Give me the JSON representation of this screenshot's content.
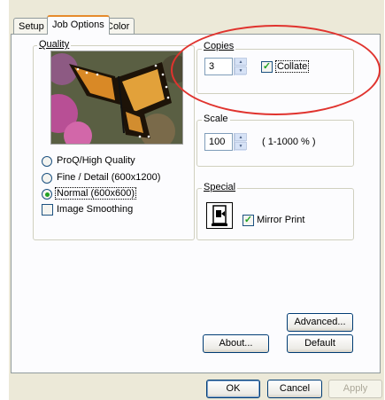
{
  "tabs": [
    {
      "label": "Setup"
    },
    {
      "label": "Job Options"
    },
    {
      "label": "Color"
    }
  ],
  "quality": {
    "legend": "Quality",
    "options": [
      {
        "label": "ProQ/High Quality"
      },
      {
        "label": "Fine / Detail (600x1200)"
      },
      {
        "label": "Normal (600x600)"
      }
    ],
    "selected_index": 2,
    "smoothing_label": "Image Smoothing",
    "smoothing_checked": false
  },
  "copies": {
    "legend": "Copies",
    "value": "3",
    "collate_label": "Collate",
    "collate_checked": true
  },
  "scale": {
    "legend": "Scale",
    "value": "100",
    "range": "( 1-1000 % )"
  },
  "special": {
    "legend": "Special",
    "mirror_label": "Mirror Print",
    "mirror_checked": true
  },
  "buttons": {
    "advanced": "Advanced...",
    "about": "About...",
    "default": "Default",
    "ok": "OK",
    "cancel": "Cancel",
    "apply": "Apply"
  },
  "colors": {
    "annotation": "#e0332e",
    "tab_highlight": "#e68b2c"
  }
}
